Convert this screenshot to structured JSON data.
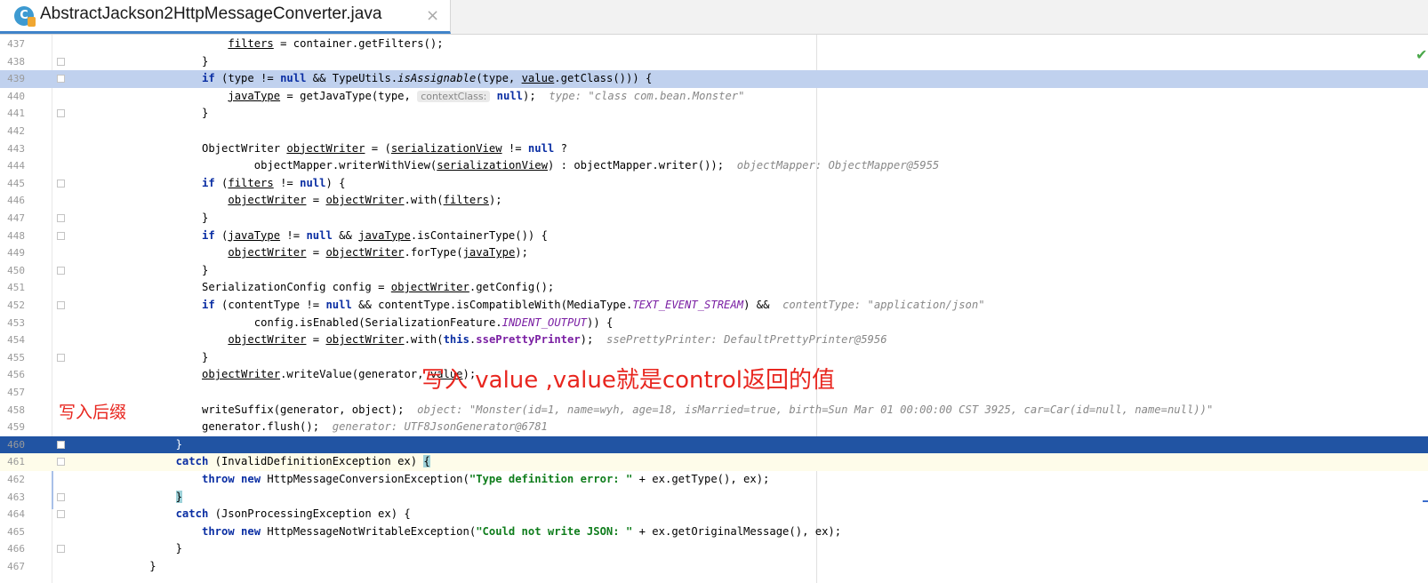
{
  "tab": {
    "icon": "java-class-icon",
    "icon_letter": "C",
    "title": "AbstractJackson2HttpMessageConverter.java",
    "close": "×"
  },
  "gutter": {
    "status": "✔"
  },
  "lines": [
    {
      "n": "437",
      "indent": 24,
      "segs": [
        {
          "t": "filters",
          "c": "ul"
        },
        {
          "t": " = container.getFilters();"
        }
      ]
    },
    {
      "n": "438",
      "indent": 20,
      "segs": [
        {
          "t": "}"
        }
      ]
    },
    {
      "n": "439",
      "indent": 20,
      "hl": "light",
      "segs": [
        {
          "t": "if",
          "c": "kw"
        },
        {
          "t": " (type != "
        },
        {
          "t": "null",
          "c": "kw"
        },
        {
          "t": " && TypeUtils."
        },
        {
          "t": "isAssignable",
          "c": "ital"
        },
        {
          "t": "(type, "
        },
        {
          "t": "value",
          "c": "ul"
        },
        {
          "t": ".getClass())) {"
        }
      ]
    },
    {
      "n": "440",
      "indent": 24,
      "segs": [
        {
          "t": "javaType",
          "c": "ul"
        },
        {
          "t": " = getJavaType(type, "
        },
        {
          "t": "contextClass:",
          "c": "chip"
        },
        {
          "t": " "
        },
        {
          "t": "null",
          "c": "kw"
        },
        {
          "t": ");  "
        },
        {
          "t": "type: \"class com.bean.Monster\"",
          "c": "hint"
        }
      ]
    },
    {
      "n": "441",
      "indent": 20,
      "segs": [
        {
          "t": "}"
        }
      ]
    },
    {
      "n": "442",
      "indent": 0,
      "segs": []
    },
    {
      "n": "443",
      "indent": 20,
      "segs": [
        {
          "t": "ObjectWriter "
        },
        {
          "t": "objectWriter",
          "c": "ul"
        },
        {
          "t": " = ("
        },
        {
          "t": "serializationView",
          "c": "ul"
        },
        {
          "t": " != "
        },
        {
          "t": "null",
          "c": "kw"
        },
        {
          "t": " ?"
        }
      ]
    },
    {
      "n": "444",
      "indent": 28,
      "segs": [
        {
          "t": "objectMapper.writerWithView("
        },
        {
          "t": "serializationView",
          "c": "ul"
        },
        {
          "t": ") : objectMapper.writer());  "
        },
        {
          "t": "objectMapper: ObjectMapper@5955",
          "c": "hint"
        }
      ]
    },
    {
      "n": "445",
      "indent": 20,
      "segs": [
        {
          "t": "if",
          "c": "kw"
        },
        {
          "t": " ("
        },
        {
          "t": "filters",
          "c": "ul"
        },
        {
          "t": " != "
        },
        {
          "t": "null",
          "c": "kw"
        },
        {
          "t": ") {"
        }
      ]
    },
    {
      "n": "446",
      "indent": 24,
      "segs": [
        {
          "t": "objectWriter",
          "c": "ul"
        },
        {
          "t": " = "
        },
        {
          "t": "objectWriter",
          "c": "ul"
        },
        {
          "t": ".with("
        },
        {
          "t": "filters",
          "c": "ul"
        },
        {
          "t": ");"
        }
      ]
    },
    {
      "n": "447",
      "indent": 20,
      "segs": [
        {
          "t": "}"
        }
      ]
    },
    {
      "n": "448",
      "indent": 20,
      "segs": [
        {
          "t": "if",
          "c": "kw"
        },
        {
          "t": " ("
        },
        {
          "t": "javaType",
          "c": "ul"
        },
        {
          "t": " != "
        },
        {
          "t": "null",
          "c": "kw"
        },
        {
          "t": " && "
        },
        {
          "t": "javaType",
          "c": "ul"
        },
        {
          "t": ".isContainerType()) {"
        }
      ]
    },
    {
      "n": "449",
      "indent": 24,
      "segs": [
        {
          "t": "objectWriter",
          "c": "ul"
        },
        {
          "t": " = "
        },
        {
          "t": "objectWriter",
          "c": "ul"
        },
        {
          "t": ".forType("
        },
        {
          "t": "javaType",
          "c": "ul"
        },
        {
          "t": ");"
        }
      ]
    },
    {
      "n": "450",
      "indent": 20,
      "segs": [
        {
          "t": "}"
        }
      ]
    },
    {
      "n": "451",
      "indent": 20,
      "segs": [
        {
          "t": "SerializationConfig config = "
        },
        {
          "t": "objectWriter",
          "c": "ul"
        },
        {
          "t": ".getConfig();"
        }
      ]
    },
    {
      "n": "452",
      "indent": 20,
      "segs": [
        {
          "t": "if",
          "c": "kw"
        },
        {
          "t": " (contentType != "
        },
        {
          "t": "null",
          "c": "kw"
        },
        {
          "t": " && contentType.isCompatibleWith(MediaType."
        },
        {
          "t": "TEXT_EVENT_STREAM",
          "c": "purple"
        },
        {
          "t": ") &&  "
        },
        {
          "t": "contentType: \"application/json\"",
          "c": "hint"
        }
      ]
    },
    {
      "n": "453",
      "indent": 28,
      "segs": [
        {
          "t": "config.isEnabled(SerializationFeature."
        },
        {
          "t": "INDENT_OUTPUT",
          "c": "purple"
        },
        {
          "t": ")) {"
        }
      ]
    },
    {
      "n": "454",
      "indent": 24,
      "segs": [
        {
          "t": "objectWriter",
          "c": "ul"
        },
        {
          "t": " = "
        },
        {
          "t": "objectWriter",
          "c": "ul"
        },
        {
          "t": ".with("
        },
        {
          "t": "this",
          "c": "kw"
        },
        {
          "t": "."
        },
        {
          "t": "ssePrettyPrinter",
          "c": "field"
        },
        {
          "t": ");  "
        },
        {
          "t": "ssePrettyPrinter: DefaultPrettyPrinter@5956",
          "c": "hint"
        }
      ]
    },
    {
      "n": "455",
      "indent": 20,
      "segs": [
        {
          "t": "}"
        }
      ]
    },
    {
      "n": "456",
      "indent": 20,
      "segs": [
        {
          "t": "objectWriter",
          "c": "ul"
        },
        {
          "t": ".writeValue(generator, "
        },
        {
          "t": "value",
          "c": "ul"
        },
        {
          "t": ");"
        }
      ]
    },
    {
      "n": "457",
      "indent": 0,
      "segs": []
    },
    {
      "n": "458",
      "indent": 20,
      "segs": [
        {
          "t": "writeSuffix(generator, object);  "
        },
        {
          "t": "object: \"Monster(id=1, name=wyh, age=18, isMarried=true, birth=Sun Mar 01 00:00:00 CST 3925, car=Car(id=null, name=null))\"",
          "c": "hint"
        }
      ]
    },
    {
      "n": "459",
      "indent": 20,
      "segs": [
        {
          "t": "generator.flush();  "
        },
        {
          "t": "generator: UTF8JsonGenerator@6781",
          "c": "hint"
        }
      ]
    },
    {
      "n": "460",
      "indent": 16,
      "hl": "dark",
      "segs": [
        {
          "t": "}"
        }
      ]
    },
    {
      "n": "461",
      "indent": 16,
      "hl": "caret",
      "segs": [
        {
          "t": "catch",
          "c": "kw"
        },
        {
          "t": " (InvalidDefinitionException ex) "
        },
        {
          "t": "{",
          "c": "brace-hl"
        }
      ]
    },
    {
      "n": "462",
      "indent": 20,
      "segs": [
        {
          "t": "throw",
          "c": "kw"
        },
        {
          "t": " "
        },
        {
          "t": "new",
          "c": "kw"
        },
        {
          "t": " HttpMessageConversionException("
        },
        {
          "t": "\"Type definition error: \"",
          "c": "str"
        },
        {
          "t": " + ex.getType(), ex);"
        }
      ]
    },
    {
      "n": "463",
      "indent": 16,
      "segs": [
        {
          "t": "}",
          "c": "brace-hl"
        }
      ]
    },
    {
      "n": "464",
      "indent": 16,
      "segs": [
        {
          "t": "catch",
          "c": "kw"
        },
        {
          "t": " (JsonProcessingException ex) {"
        }
      ]
    },
    {
      "n": "465",
      "indent": 20,
      "segs": [
        {
          "t": "throw",
          "c": "kw"
        },
        {
          "t": " "
        },
        {
          "t": "new",
          "c": "kw"
        },
        {
          "t": " HttpMessageNotWritableException("
        },
        {
          "t": "\"Could not write JSON: \"",
          "c": "str"
        },
        {
          "t": " + ex.getOriginalMessage(), ex);"
        }
      ]
    },
    {
      "n": "466",
      "indent": 16,
      "segs": [
        {
          "t": "}"
        }
      ]
    },
    {
      "n": "467",
      "indent": 12,
      "segs": [
        {
          "t": "}"
        }
      ]
    }
  ],
  "annotations": {
    "main": "写入 value ,value就是control返回的值",
    "side": "写入后缀"
  },
  "colors": {
    "accent": "#4083c9",
    "line_highlight": "#c0d1ee",
    "execution_line": "#2154a3",
    "annotation": "#e8261f"
  }
}
